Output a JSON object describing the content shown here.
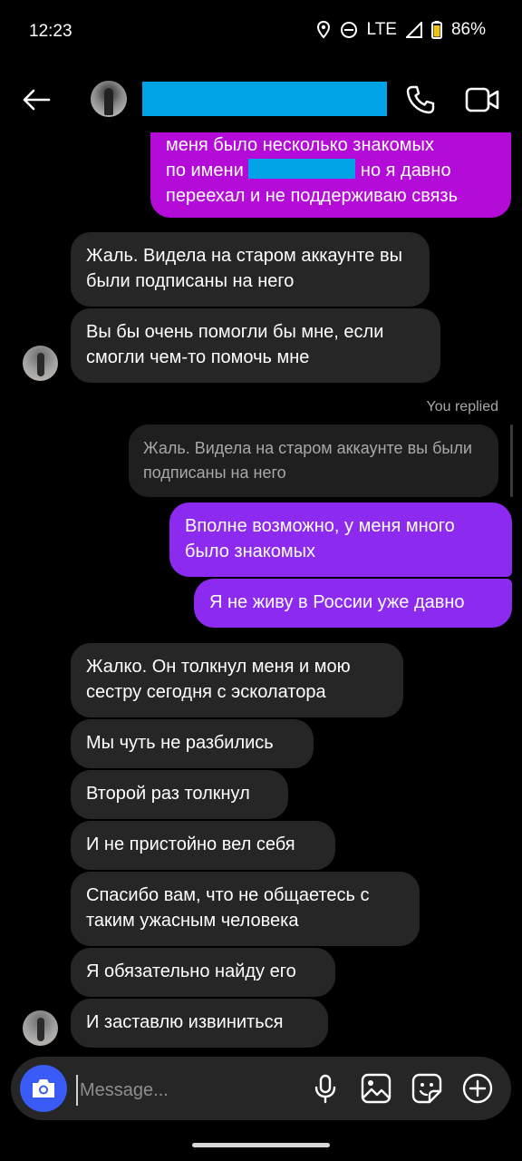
{
  "status": {
    "time": "12:23",
    "network": "LTE",
    "battery": "86%"
  },
  "header": {
    "contact_name": ""
  },
  "messages": {
    "m0_line1": "меня было несколько знакомых",
    "m0_line2a": "по имени",
    "m0_line2b": "но я давно",
    "m0_line3": "переехал и не поддерживаю связь",
    "m1": "Жаль. Видела на старом аккаунте вы были подписаны на него",
    "m2": "Вы бы очень помогли бы мне, если смогли чем-то помочь мне",
    "you_replied": "You replied",
    "reply_quote": "Жаль. Видела на старом аккаунте вы были подписаны на него",
    "m3": "Вполне возможно, у меня много было знакомых",
    "m4": "Я не живу в России уже давно",
    "m5": "Жалко. Он толкнул меня и мою сестру сегодня с эсколатора",
    "m6": "Мы чуть не разбились",
    "m7": "Второй раз толкнул",
    "m8": "И не пристойно вел себя",
    "m9": "Спасибо вам, что не общаетесь с таким ужасным человека",
    "m10": "Я обязательно найду его",
    "m11": "И заставлю извиниться"
  },
  "composer": {
    "placeholder": "Message..."
  },
  "colors": {
    "incoming": "#262626",
    "outgoing_magenta": "#b50bd9",
    "outgoing_purple": "#8d2af0",
    "camera": "#3b5bf6",
    "redaction": "#00a3e6"
  },
  "icons": [
    "back-arrow-icon",
    "phone-icon",
    "video-camera-icon",
    "camera-icon",
    "microphone-icon",
    "gallery-icon",
    "sticker-icon",
    "plus-icon",
    "location-icon",
    "do-not-disturb-icon",
    "signal-icon",
    "battery-icon"
  ]
}
